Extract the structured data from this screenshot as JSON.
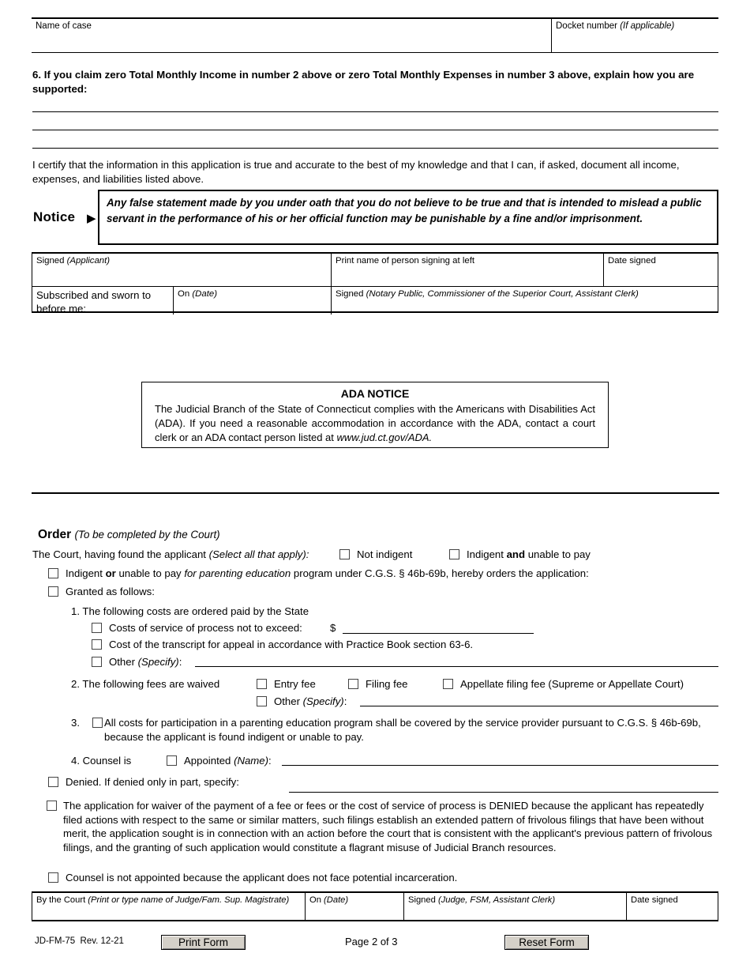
{
  "header": {
    "name_of_case_label": "Name of case",
    "docket_label": "Docket number",
    "docket_note": "(If applicable)"
  },
  "question6": {
    "text": "6. If you claim zero Total Monthly Income in number 2 above or zero Total Monthly Expenses in number 3 above, explain how you are supported:"
  },
  "certification": {
    "text": "I certify that the information in this application is true and accurate to the best of my knowledge and that I can, if asked, document all income, expenses, and liabilities listed above."
  },
  "notice": {
    "label": "Notice",
    "arrow": "▶",
    "text": "Any false statement made by you under oath that you do not believe to be true and that is intended to mislead a public servant in the performance of his or her official function may be punishable by a fine and/or imprisonment."
  },
  "signature_table": {
    "signed_applicant_label": "Signed",
    "signed_applicant_note": "(Applicant)",
    "print_name_label": "Print name of person signing at left",
    "date_signed_label": "Date signed",
    "subscribed_label": "Subscribed and sworn to before me:",
    "on_date_label": "On",
    "on_date_note": "(Date)",
    "signed_notary_label": "Signed",
    "signed_notary_note": "(Notary Public, Commissioner of the Superior Court, Assistant Clerk)"
  },
  "ada": {
    "title": "ADA NOTICE",
    "body_part1": "The Judicial Branch of the State of Connecticut complies with the Americans with Disabilities Act (ADA). If you need a reasonable accommodation in accordance with the ADA, contact a court clerk or an ADA contact person listed at ",
    "url": "www.jud.ct.gov/ADA."
  },
  "order": {
    "title": "Order",
    "subtitle": "(To be completed by the Court)",
    "court_found_lead": "The Court, having found the applicant ",
    "court_found_note": "(Select all that apply):",
    "opt_not_indigent": "Not indigent",
    "opt_indigent_pre": "Indigent ",
    "opt_indigent_bold": "and",
    "opt_indigent_post": " unable to pay",
    "parenting_pre": "Indigent ",
    "parenting_bold": "or",
    "parenting_mid": " unable to pay ",
    "parenting_italic": "for parenting education",
    "parenting_post": " program under C.G.S. § 46b-69b, hereby orders the application:",
    "granted": "Granted as follows:",
    "item1_title": "1. The following costs are ordered paid by the State",
    "item1_a": "Costs of service of process not to exceed:",
    "item1_a_dollar": "$",
    "item1_b": "Cost of the transcript for appeal in accordance with Practice Book section 63-6.",
    "item1_c_label": "Other ",
    "item1_c_note": "(Specify)",
    "item1_c_colon": ":",
    "item2_title": "2. The following fees are waived",
    "item2_entry": "Entry fee",
    "item2_filing": "Filing fee",
    "item2_appellate": "Appellate filing fee (Supreme or Appellate Court)",
    "item2_other_label": "Other ",
    "item2_other_note": "(Specify)",
    "item2_other_colon": ":",
    "item3_number": "3.",
    "item3_text": "All costs for participation in a parenting education program shall be covered by the service provider pursuant to C.G.S. § 46b-69b, because the applicant is found indigent or unable to pay.",
    "item4_label": "4. Counsel is",
    "item4_appointed": "Appointed ",
    "item4_name_note": "(Name)",
    "item4_colon": ":",
    "denied": "Denied. If denied only in part, specify:",
    "denied_long": "The application for waiver of the payment of a fee or fees or the cost of service of process is DENIED because the applicant has repeatedly filed actions with respect to the same or similar matters, such filings establish an extended pattern of frivolous filings that have been without merit, the application sought is in connection with an action before the court that is consistent with the applicant's previous pattern of frivolous filings, and the granting of such application would constitute a flagrant misuse of Judicial Branch resources.",
    "counsel_not_appointed": "Counsel is not appointed because the applicant does not face potential incarceration."
  },
  "footer_table": {
    "by_the_court_label": "By the Court ",
    "by_the_court_note": "(Print or type name of Judge/Fam. Sup. Magistrate)",
    "on_date_label": "On ",
    "on_date_note": "(Date)",
    "signed_label": "Signed ",
    "signed_note": "(Judge, FSM, Assistant Clerk)",
    "date_signed_label": "Date signed"
  },
  "bottom": {
    "form_id": "JD-FM-75",
    "revision": "Rev. 12-21",
    "print_button": "Print Form",
    "page_label": "Page 2 of 3",
    "reset_button": "Reset Form"
  },
  "colors": {
    "ink": "#000000",
    "button_face": "#d4d0c8",
    "checkbox_border": "#444444"
  }
}
